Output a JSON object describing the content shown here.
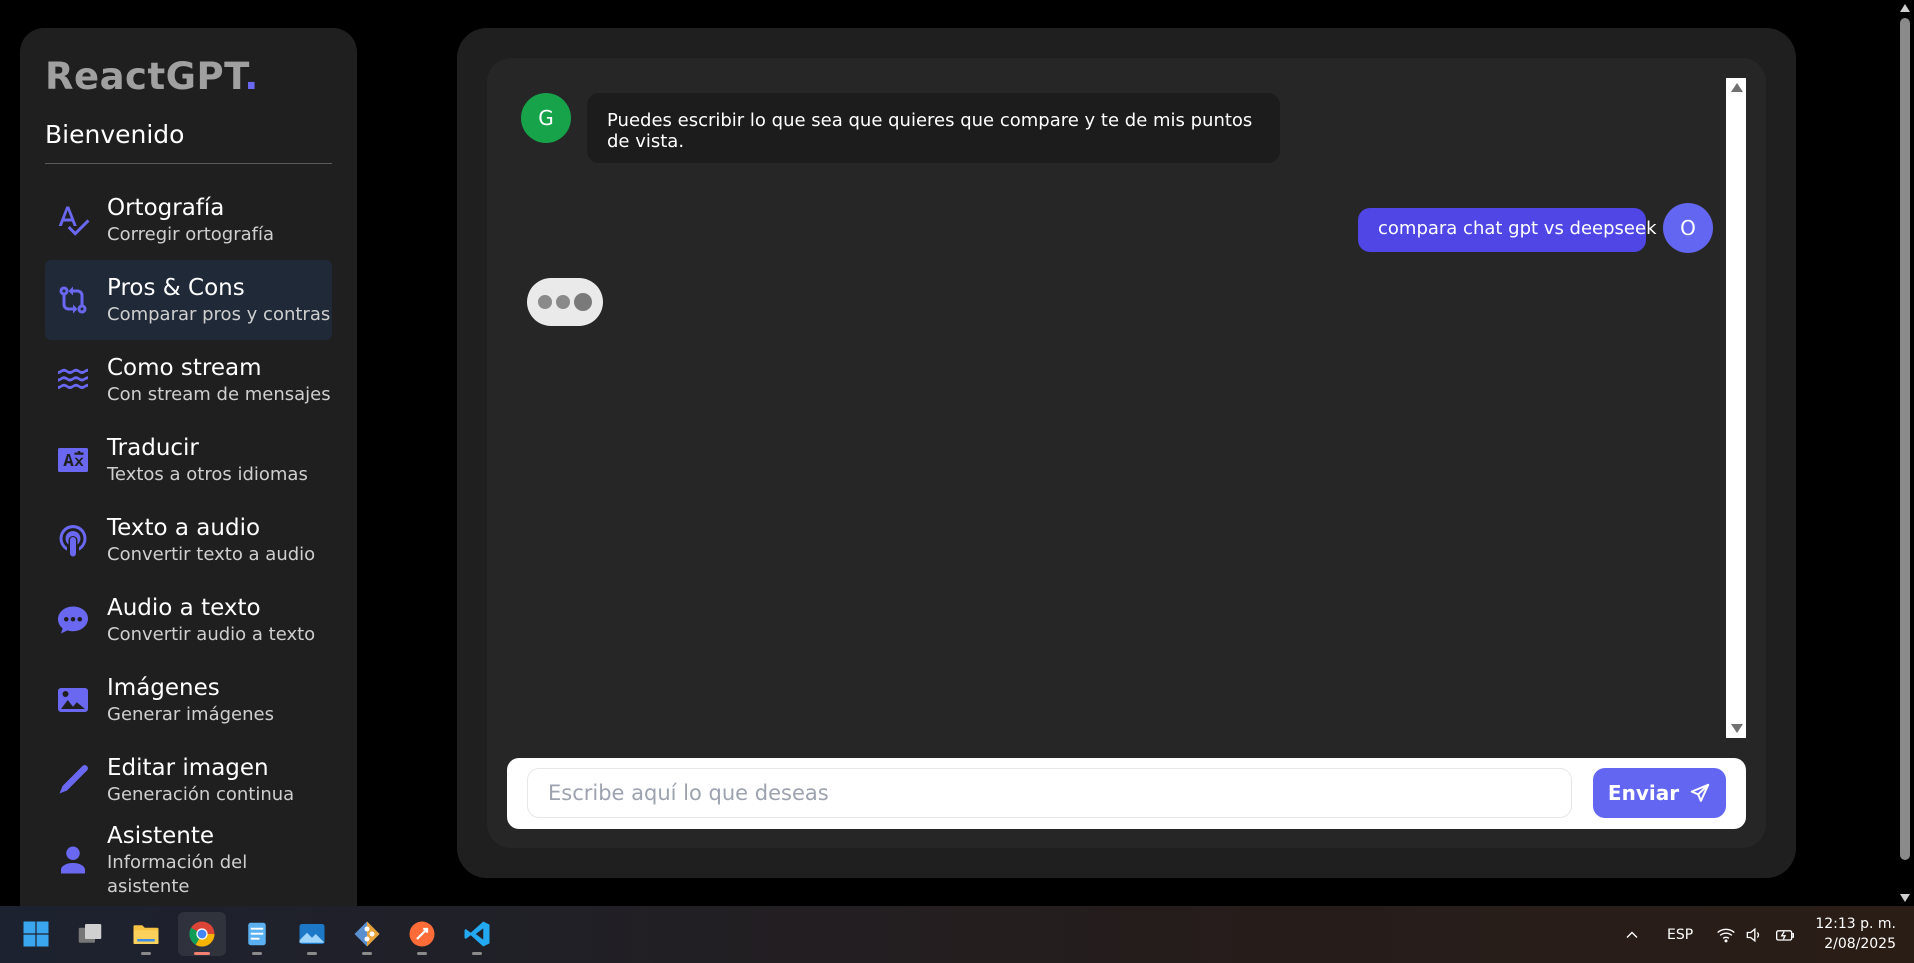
{
  "sidebar": {
    "logo_text": "ReactGPT",
    "logo_dot": ".",
    "welcome": "Bienvenido",
    "items": [
      {
        "title": "Ortografía",
        "subtitle": "Corregir ortografía",
        "icon": "spellcheck-icon",
        "active": false
      },
      {
        "title": "Pros & Cons",
        "subtitle": "Comparar pros y contras",
        "icon": "compare-arrows-icon",
        "active": true
      },
      {
        "title": "Como stream",
        "subtitle": "Con stream de mensajes",
        "icon": "waves-icon",
        "active": false
      },
      {
        "title": "Traducir",
        "subtitle": "Textos a otros idiomas",
        "icon": "translate-icon",
        "active": false
      },
      {
        "title": "Texto a audio",
        "subtitle": "Convertir texto a audio",
        "icon": "podcast-icon",
        "active": false
      },
      {
        "title": "Audio a texto",
        "subtitle": "Convertir audio a texto",
        "icon": "chat-bubble-icon",
        "active": false
      },
      {
        "title": "Imágenes",
        "subtitle": "Generar imágenes",
        "icon": "image-icon",
        "active": false
      },
      {
        "title": "Editar imagen",
        "subtitle": "Generación continua",
        "icon": "pencil-icon",
        "active": false
      },
      {
        "title": "Asistente",
        "subtitle": "Información del asistente",
        "icon": "user-icon",
        "active": false
      }
    ]
  },
  "chat": {
    "gpt_avatar": "G",
    "user_avatar": "O",
    "gpt_message": "Puedes escribir lo que sea que quieres que compare y te de mis puntos de vista.",
    "user_message": "compara chat gpt vs deepseek",
    "input_placeholder": "Escribe aquí lo que deseas",
    "input_value": "",
    "send_label": "Enviar"
  },
  "taskbar": {
    "apps": [
      "windows-start-icon",
      "task-view-icon",
      "file-explorer-icon",
      "chrome-icon",
      "notepad-icon",
      "photos-icon",
      "git-icon",
      "postman-icon",
      "vscode-icon"
    ],
    "language": "ESP",
    "time": "12:13 p. m.",
    "date": "2/08/2025"
  },
  "colors": {
    "accent": "#6366f1",
    "user_bubble": "#4f46e5",
    "gpt_avatar": "#16a34a",
    "sidebar_bg": "#1f1f1f",
    "chat_bg": "#262626"
  }
}
